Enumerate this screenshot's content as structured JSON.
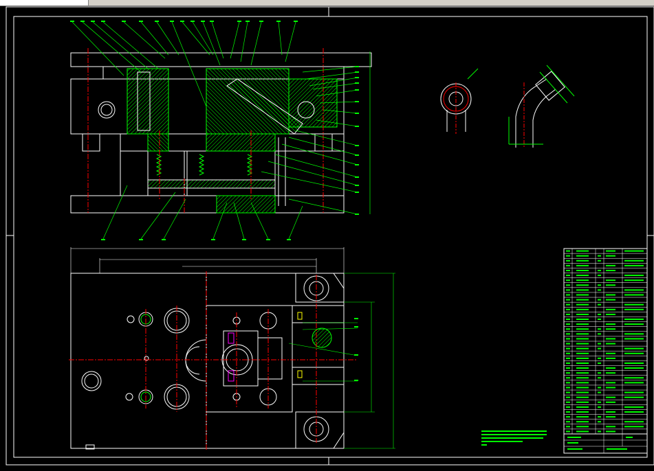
{
  "window": {
    "title": ""
  },
  "colors": {
    "background": "#000000",
    "outline": "#ffffff",
    "hatch": "#00ff00",
    "centerline": "#ff0000",
    "accent": "#ff00ff",
    "highlight": "#ffff00"
  },
  "drawing": {
    "section_view": {
      "name": "section-view"
    },
    "plan_view": {
      "name": "plan-view"
    },
    "detail_view": {
      "name": "detail-view"
    },
    "bom": {
      "name": "bill-of-materials",
      "rows": 38
    },
    "title_block": {
      "name": "title-block"
    }
  }
}
